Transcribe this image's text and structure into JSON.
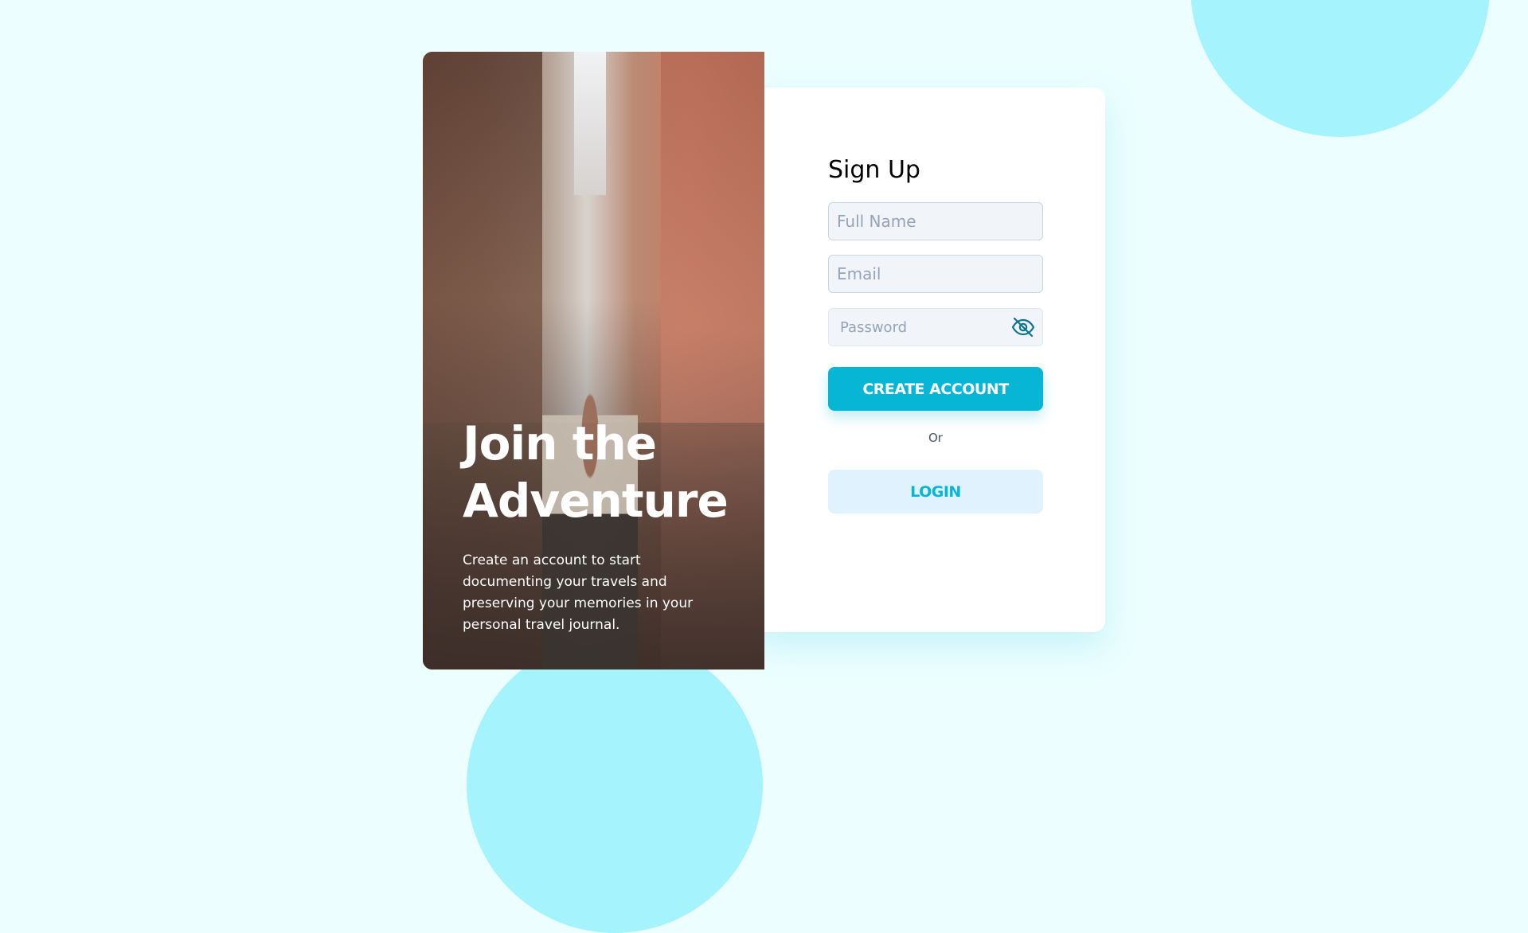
{
  "hero": {
    "title": "Join the Adventure",
    "subtitle": "Create an account to start documenting your travels and preserving your memories in your personal travel journal."
  },
  "signup": {
    "title": "Sign Up",
    "full_name_placeholder": "Full Name",
    "full_name_value": "",
    "email_placeholder": "Email",
    "email_value": "",
    "password_placeholder": "Password",
    "password_value": "",
    "password_toggle_icon": "eye-off-icon",
    "create_account_label": "CREATE ACCOUNT",
    "or_label": "Or",
    "login_label": "LOGIN"
  },
  "colors": {
    "background": "#ecfeff",
    "blob": "#a5f3fc",
    "accent": "#06b6d4",
    "login_button_bg": "#e0f2fe",
    "card": "#ffffff"
  }
}
